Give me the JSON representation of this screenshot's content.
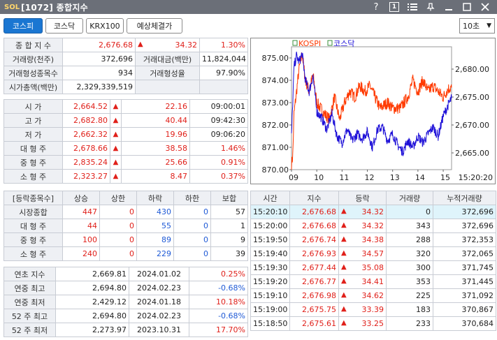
{
  "window": {
    "logo": "SOL",
    "title": "[1072] 종합지수"
  },
  "tabs": [
    "코스피",
    "코스닥",
    "KRX100",
    "예상체결가"
  ],
  "interval": "10초",
  "summary": {
    "index_label": "종 합 지 수",
    "index_value": "2,676.68",
    "index_change": "34.32",
    "index_rate": "1.30%",
    "volume_label": "거래량(천주)",
    "volume_value": "372,696",
    "amount_label": "거래대금(백만)",
    "amount_value": "11,824,044",
    "formed_count_label": "거래형성종목수",
    "formed_count_value": "934",
    "formed_rate_label": "거래형성율",
    "formed_rate_value": "97.90%",
    "cap_label": "시가총액(백만)",
    "cap_value": "2,329,339,519"
  },
  "prices": [
    {
      "label": "시  가",
      "value": "2,664.52",
      "change": "22.16",
      "extra": "09:00:01"
    },
    {
      "label": "고  가",
      "value": "2,682.80",
      "change": "40.44",
      "extra": "09:42:30"
    },
    {
      "label": "저  가",
      "value": "2,662.32",
      "change": "19.96",
      "extra": "09:06:20"
    },
    {
      "label": "대 형 주",
      "value": "2,678.66",
      "change": "38.58",
      "extra": "1.46%"
    },
    {
      "label": "중 형 주",
      "value": "2,835.24",
      "change": "25.66",
      "extra": "0.91%"
    },
    {
      "label": "소 형 주",
      "value": "2,323.27",
      "change": "8.47",
      "extra": "0.37%"
    }
  ],
  "breadth": {
    "headers": [
      "[등락종목수]",
      "상승",
      "상한",
      "하락",
      "하한",
      "보합"
    ],
    "rows": [
      {
        "label": "시장종합",
        "up": "447",
        "upper": "0",
        "down": "430",
        "lower": "0",
        "flat": "57"
      },
      {
        "label": "대 형 주",
        "up": "44",
        "upper": "0",
        "down": "55",
        "lower": "0",
        "flat": "1"
      },
      {
        "label": "중 형 주",
        "up": "100",
        "upper": "0",
        "down": "89",
        "lower": "0",
        "flat": "9"
      },
      {
        "label": "소 형 주",
        "up": "240",
        "upper": "0",
        "down": "229",
        "lower": "0",
        "flat": "39"
      }
    ]
  },
  "yearly": [
    {
      "label": "연초  지수",
      "value": "2,669.81",
      "date": "2024.01.02",
      "rate": "0.25%"
    },
    {
      "label": "연중  최고",
      "value": "2,694.80",
      "date": "2024.02.23",
      "rate": "-0.68%"
    },
    {
      "label": "연중  최저",
      "value": "2,429.12",
      "date": "2024.01.18",
      "rate": "10.18%"
    },
    {
      "label": "52 주 최고",
      "value": "2,694.80",
      "date": "2024.02.23",
      "rate": "-0.68%"
    },
    {
      "label": "52 주 최저",
      "value": "2,273.97",
      "date": "2023.10.31",
      "rate": "17.70%"
    }
  ],
  "ticks": {
    "headers": [
      "시간",
      "지수",
      "등락",
      "거래량",
      "누적거래량"
    ],
    "rows": [
      {
        "time": "15:20:10",
        "index": "2,676.68",
        "change": "34.32",
        "vol": "0",
        "cum": "372,696"
      },
      {
        "time": "15:20:00",
        "index": "2,676.68",
        "change": "34.32",
        "vol": "343",
        "cum": "372,696"
      },
      {
        "time": "15:19:50",
        "index": "2,676.74",
        "change": "34.38",
        "vol": "288",
        "cum": "372,353"
      },
      {
        "time": "15:19:40",
        "index": "2,676.93",
        "change": "34.57",
        "vol": "320",
        "cum": "372,065"
      },
      {
        "time": "15:19:30",
        "index": "2,677.44",
        "change": "35.08",
        "vol": "300",
        "cum": "371,745"
      },
      {
        "time": "15:19:20",
        "index": "2,676.77",
        "change": "34.41",
        "vol": "353",
        "cum": "371,445"
      },
      {
        "time": "15:19:10",
        "index": "2,676.98",
        "change": "34.62",
        "vol": "225",
        "cum": "371,092"
      },
      {
        "time": "15:19:00",
        "index": "2,675.75",
        "change": "33.39",
        "vol": "183",
        "cum": "370,867"
      },
      {
        "time": "15:18:50",
        "index": "2,675.61",
        "change": "33.25",
        "vol": "233",
        "cum": "370,684"
      }
    ]
  },
  "chart_data": {
    "type": "line",
    "legend": [
      "KOSPI",
      "코스닥"
    ],
    "legend_position": "top",
    "x_ticks": [
      "09",
      "10",
      "11",
      "12",
      "13",
      "14",
      "15"
    ],
    "x_last_label": "15:20:20",
    "left_axis": {
      "ticks": [
        "875.00",
        "874.00",
        "873.00",
        "872.00",
        "871.00",
        "870.00"
      ],
      "range": [
        870,
        875.5
      ]
    },
    "right_axis": {
      "ticks": [
        "2,680.00",
        "2,675.00",
        "2,670.00",
        "2,665.00"
      ],
      "range": [
        2662,
        2684
      ]
    },
    "colors": {
      "kospi": "#ff3a00",
      "kosdaq": "#1e10d8"
    },
    "kospi_keypoints": [
      [
        9.0,
        2663
      ],
      [
        9.05,
        2664.5
      ],
      [
        9.1,
        2672
      ],
      [
        9.2,
        2676
      ],
      [
        9.3,
        2680
      ],
      [
        9.42,
        2682.8
      ],
      [
        9.55,
        2678
      ],
      [
        9.7,
        2676
      ],
      [
        9.85,
        2679
      ],
      [
        10.0,
        2674
      ],
      [
        10.15,
        2673
      ],
      [
        10.3,
        2672
      ],
      [
        10.5,
        2671
      ],
      [
        10.7,
        2675
      ],
      [
        10.9,
        2671
      ],
      [
        11.1,
        2674
      ],
      [
        11.3,
        2676
      ],
      [
        11.5,
        2675
      ],
      [
        11.7,
        2677
      ],
      [
        11.9,
        2676
      ],
      [
        12.1,
        2677
      ],
      [
        12.3,
        2675
      ],
      [
        12.5,
        2673
      ],
      [
        12.8,
        2674
      ],
      [
        13.0,
        2673
      ],
      [
        13.3,
        2673
      ],
      [
        13.6,
        2675
      ],
      [
        13.8,
        2678
      ],
      [
        14.0,
        2676
      ],
      [
        14.2,
        2678
      ],
      [
        14.4,
        2676
      ],
      [
        14.6,
        2677
      ],
      [
        14.8,
        2676
      ],
      [
        15.0,
        2675
      ],
      [
        15.2,
        2676.5
      ],
      [
        15.33,
        2676.7
      ]
    ],
    "kosdaq_keypoints": [
      [
        9.0,
        871.5
      ],
      [
        9.05,
        873
      ],
      [
        9.1,
        874.6
      ],
      [
        9.2,
        875.1
      ],
      [
        9.3,
        874.8
      ],
      [
        9.42,
        875.2
      ],
      [
        9.55,
        874
      ],
      [
        9.7,
        873.5
      ],
      [
        9.85,
        874.2
      ],
      [
        10.0,
        872.6
      ],
      [
        10.2,
        872.3
      ],
      [
        10.4,
        871.8
      ],
      [
        10.6,
        872.5
      ],
      [
        10.8,
        871.5
      ],
      [
        11.0,
        871.2
      ],
      [
        11.2,
        871.8
      ],
      [
        11.4,
        871.3
      ],
      [
        11.6,
        871.6
      ],
      [
        11.8,
        871.4
      ],
      [
        12.0,
        871.7
      ],
      [
        12.2,
        871.0
      ],
      [
        12.4,
        871.8
      ],
      [
        12.6,
        871.9
      ],
      [
        12.8,
        871.3
      ],
      [
        13.0,
        871.6
      ],
      [
        13.2,
        871.1
      ],
      [
        13.4,
        870.8
      ],
      [
        13.6,
        871.3
      ],
      [
        13.8,
        871.0
      ],
      [
        14.0,
        871.5
      ],
      [
        14.2,
        871.2
      ],
      [
        14.4,
        871.6
      ],
      [
        14.6,
        871.9
      ],
      [
        14.8,
        871.5
      ],
      [
        15.0,
        872.4
      ],
      [
        15.2,
        872.9
      ],
      [
        15.33,
        873.2
      ]
    ]
  }
}
